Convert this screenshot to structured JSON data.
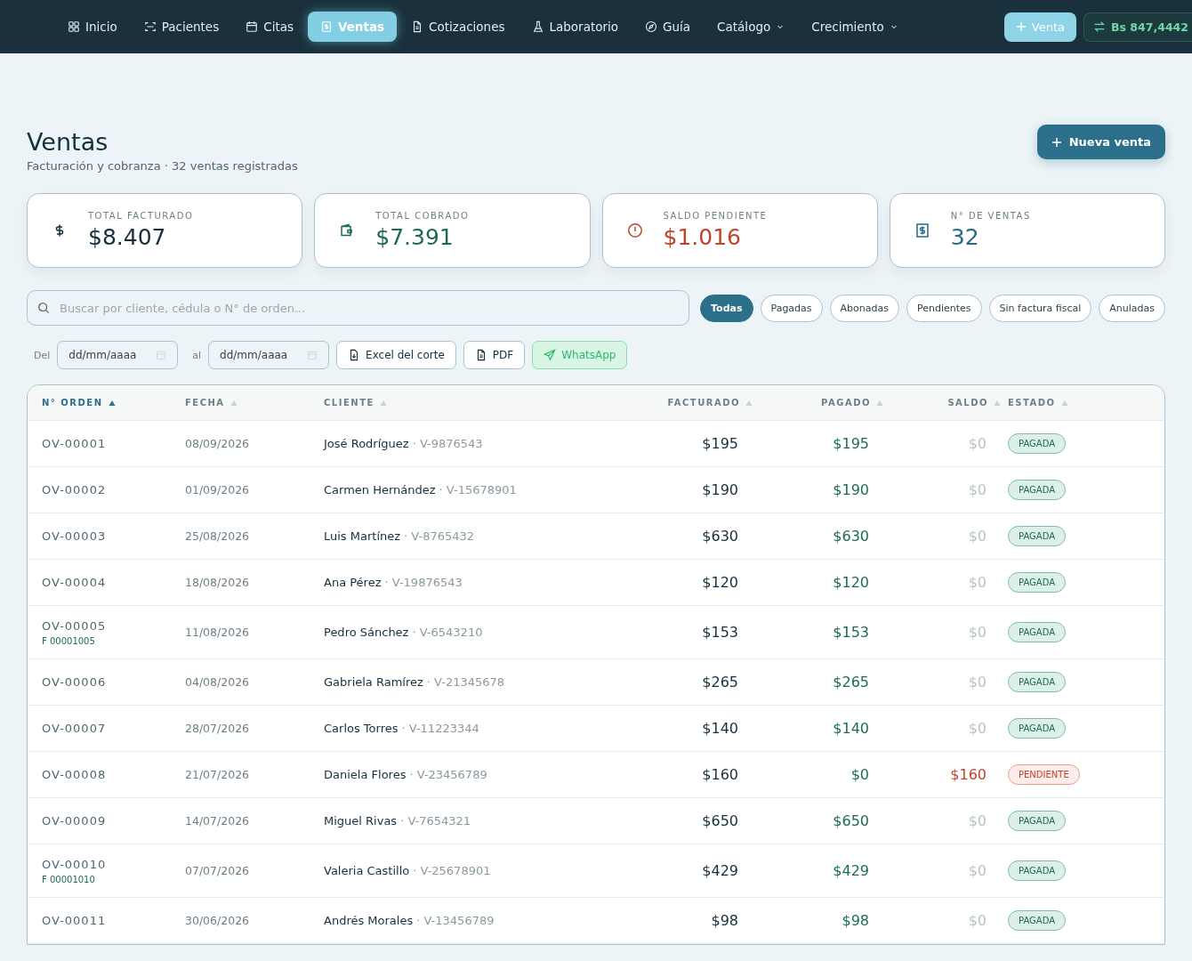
{
  "nav": {
    "items": [
      {
        "label": "Inicio",
        "selected": false,
        "dropdown": false
      },
      {
        "label": "Pacientes",
        "selected": false,
        "dropdown": false
      },
      {
        "label": "Citas",
        "selected": false,
        "dropdown": false
      },
      {
        "label": "Ventas",
        "selected": true,
        "dropdown": false
      },
      {
        "label": "Cotizaciones",
        "selected": false,
        "dropdown": false
      },
      {
        "label": "Laboratorio",
        "selected": false,
        "dropdown": false
      },
      {
        "label": "Guía",
        "selected": false,
        "dropdown": false
      },
      {
        "label": "Catálogo",
        "selected": false,
        "dropdown": true
      },
      {
        "label": "Crecimiento",
        "selected": false,
        "dropdown": true
      }
    ],
    "new_sale_button": "Venta",
    "exchange_rate": "Bs 847,4442"
  },
  "header": {
    "title": "Ventas",
    "subtitle": "Facturación y cobranza · 32 ventas registradas",
    "new_button": "Nueva venta"
  },
  "stats": [
    {
      "label": "TOTAL FACTURADO",
      "value": "$8.407",
      "kind": "dollar",
      "color": "#15303c"
    },
    {
      "label": "TOTAL COBRADO",
      "value": "$7.391",
      "kind": "wallet",
      "color": "#1d6b55"
    },
    {
      "label": "SALDO PENDIENTE",
      "value": "$1.016",
      "kind": "alert",
      "color": "#c0432e"
    },
    {
      "label": "N° DE VENTAS",
      "value": "32",
      "kind": "receipt",
      "color": "#276a85"
    }
  ],
  "search": {
    "placeholder": "Buscar por cliente, cédula o N° de orden..."
  },
  "filters": [
    {
      "label": "Todas",
      "selected": true
    },
    {
      "label": "Pagadas",
      "selected": false
    },
    {
      "label": "Abonadas",
      "selected": false
    },
    {
      "label": "Pendientes",
      "selected": false
    },
    {
      "label": "Sin factura fiscal",
      "selected": false
    },
    {
      "label": "Anuladas",
      "selected": false
    }
  ],
  "date_range": {
    "from_label": "Del",
    "from_placeholder": "dd/mm/aaaa",
    "to_label": "al",
    "to_placeholder": "dd/mm/aaaa"
  },
  "exports": [
    {
      "label": "Excel del corte",
      "kind": "excel"
    },
    {
      "label": "PDF",
      "kind": "pdf"
    },
    {
      "label": "WhatsApp",
      "kind": "whatsapp"
    }
  ],
  "table": {
    "columns": [
      {
        "label": "N° ORDEN",
        "selected": true
      },
      {
        "label": "FECHA",
        "selected": false
      },
      {
        "label": "CLIENTE",
        "selected": false
      },
      {
        "label": "FACTURADO",
        "selected": false
      },
      {
        "label": "PAGADO",
        "selected": false
      },
      {
        "label": "SALDO",
        "selected": false
      },
      {
        "label": "ESTADO",
        "selected": false
      }
    ],
    "rows": [
      {
        "order": "OV-00001",
        "date": "08/09/2026",
        "client": "José Rodríguez",
        "id": "· V-9876543",
        "billed": "$195",
        "paid": "$195",
        "balance": "$0",
        "status": "PAGADA",
        "kind": "paid"
      },
      {
        "order": "OV-00002",
        "date": "01/09/2026",
        "client": "Carmen Hernández",
        "id": "· V-15678901",
        "billed": "$190",
        "paid": "$190",
        "balance": "$0",
        "status": "PAGADA",
        "kind": "paid"
      },
      {
        "order": "OV-00003",
        "date": "25/08/2026",
        "client": "Luis Martínez",
        "id": "· V-8765432",
        "billed": "$630",
        "paid": "$630",
        "balance": "$0",
        "status": "PAGADA",
        "kind": "paid"
      },
      {
        "order": "OV-00004",
        "date": "18/08/2026",
        "client": "Ana Pérez",
        "id": "· V-19876543",
        "billed": "$120",
        "paid": "$120",
        "balance": "$0",
        "status": "PAGADA",
        "kind": "paid"
      },
      {
        "order": "OV-00005",
        "invoice": "F 00001005",
        "date": "11/08/2026",
        "client": "Pedro Sánchez",
        "id": "· V-6543210",
        "billed": "$153",
        "paid": "$153",
        "balance": "$0",
        "status": "PAGADA",
        "kind": "paid"
      },
      {
        "order": "OV-00006",
        "date": "04/08/2026",
        "client": "Gabriela Ramírez",
        "id": "· V-21345678",
        "billed": "$265",
        "paid": "$265",
        "balance": "$0",
        "status": "PAGADA",
        "kind": "paid"
      },
      {
        "order": "OV-00007",
        "date": "28/07/2026",
        "client": "Carlos Torres",
        "id": "· V-11223344",
        "billed": "$140",
        "paid": "$140",
        "balance": "$0",
        "status": "PAGADA",
        "kind": "paid"
      },
      {
        "order": "OV-00008",
        "date": "21/07/2026",
        "client": "Daniela Flores",
        "id": "· V-23456789",
        "billed": "$160",
        "paid": "$0",
        "balance": "$160",
        "status": "PENDIENTE",
        "kind": "pending"
      },
      {
        "order": "OV-00009",
        "date": "14/07/2026",
        "client": "Miguel Rivas",
        "id": "· V-7654321",
        "billed": "$650",
        "paid": "$650",
        "balance": "$0",
        "status": "PAGADA",
        "kind": "paid"
      },
      {
        "order": "OV-00010",
        "invoice": "F 00001010",
        "date": "07/07/2026",
        "client": "Valeria Castillo",
        "id": "· V-25678901",
        "billed": "$429",
        "paid": "$429",
        "balance": "$0",
        "status": "PAGADA",
        "kind": "paid"
      },
      {
        "order": "OV-00011",
        "date": "30/06/2026",
        "client": "Andrés Morales",
        "id": "· V-13456789",
        "billed": "$98",
        "paid": "$98",
        "balance": "$0",
        "status": "PAGADA",
        "kind": "paid"
      }
    ]
  }
}
